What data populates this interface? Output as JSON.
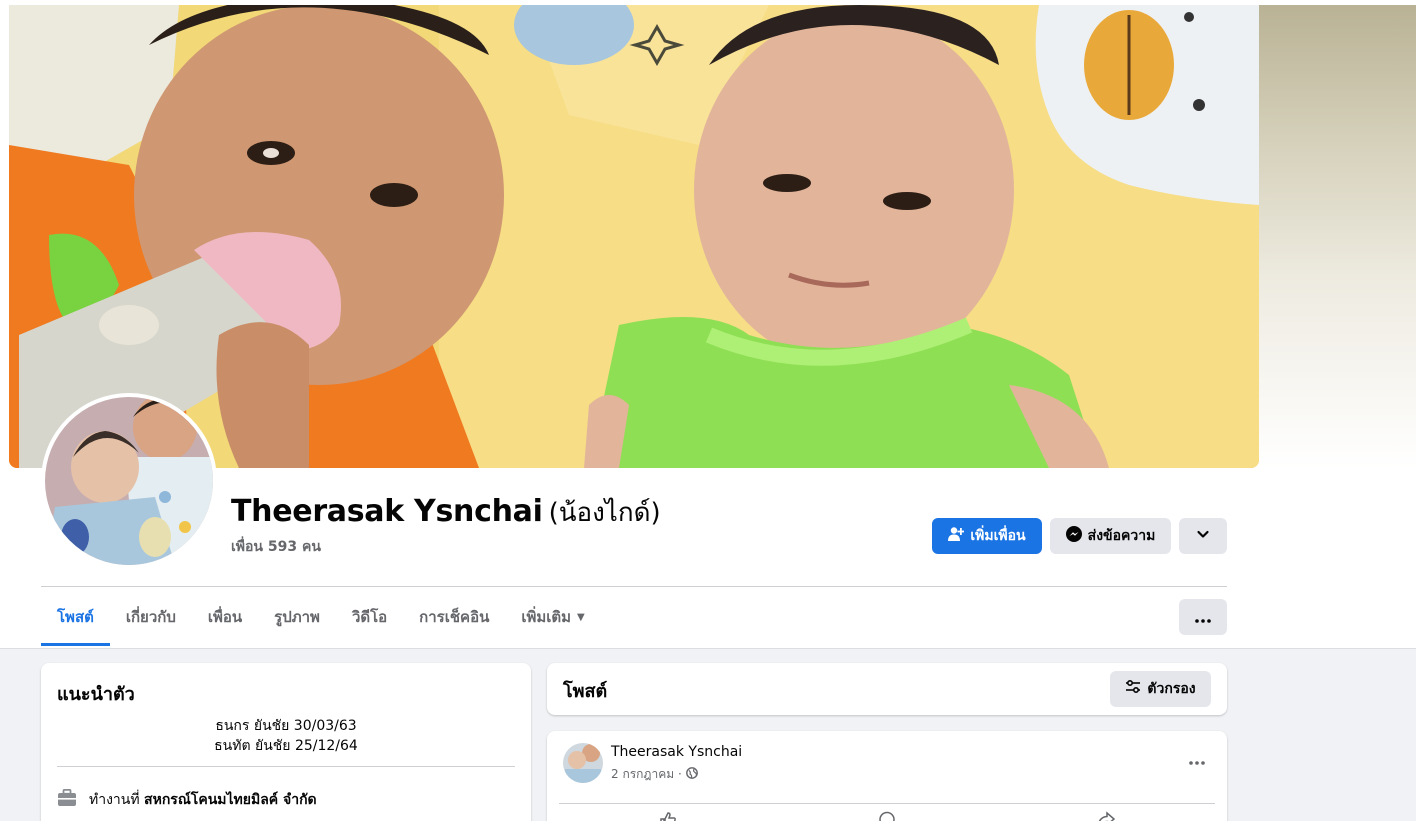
{
  "profile": {
    "name": "Theerasak Ysnchai",
    "nickname": "(น้องไกด์)",
    "friend_count_text": "เพื่อน 593 คน"
  },
  "actions": {
    "add_friend": "เพิ่มเพื่อน",
    "message": "ส่งข้อความ"
  },
  "tabs": [
    {
      "label": "โพสต์",
      "active": true
    },
    {
      "label": "เกี่ยวกับ"
    },
    {
      "label": "เพื่อน"
    },
    {
      "label": "รูปภาพ"
    },
    {
      "label": "วิดีโอ"
    },
    {
      "label": "การเช็คอิน"
    },
    {
      "label": "เพิ่มเติม"
    }
  ],
  "intro": {
    "title": "แนะนำตัว",
    "bio_line1": "ธนกร ยันชัย 30/03/63",
    "bio_line2": "ธนทัต ยันชัย 25/12/64",
    "work_prefix": "ทำงานที่",
    "work_place": "สหกรณ์โคนมไทยมิลค์ จำกัด"
  },
  "posts": {
    "title": "โพสต์",
    "filter_label": "ตัวกรอง"
  },
  "post": {
    "author": "Theerasak Ysnchai",
    "date": "2 กรกฎาคม ·"
  },
  "colors": {
    "accent": "#1b74e4",
    "secondary_button": "#e4e6eb",
    "page_bg": "#f0f2f5"
  }
}
